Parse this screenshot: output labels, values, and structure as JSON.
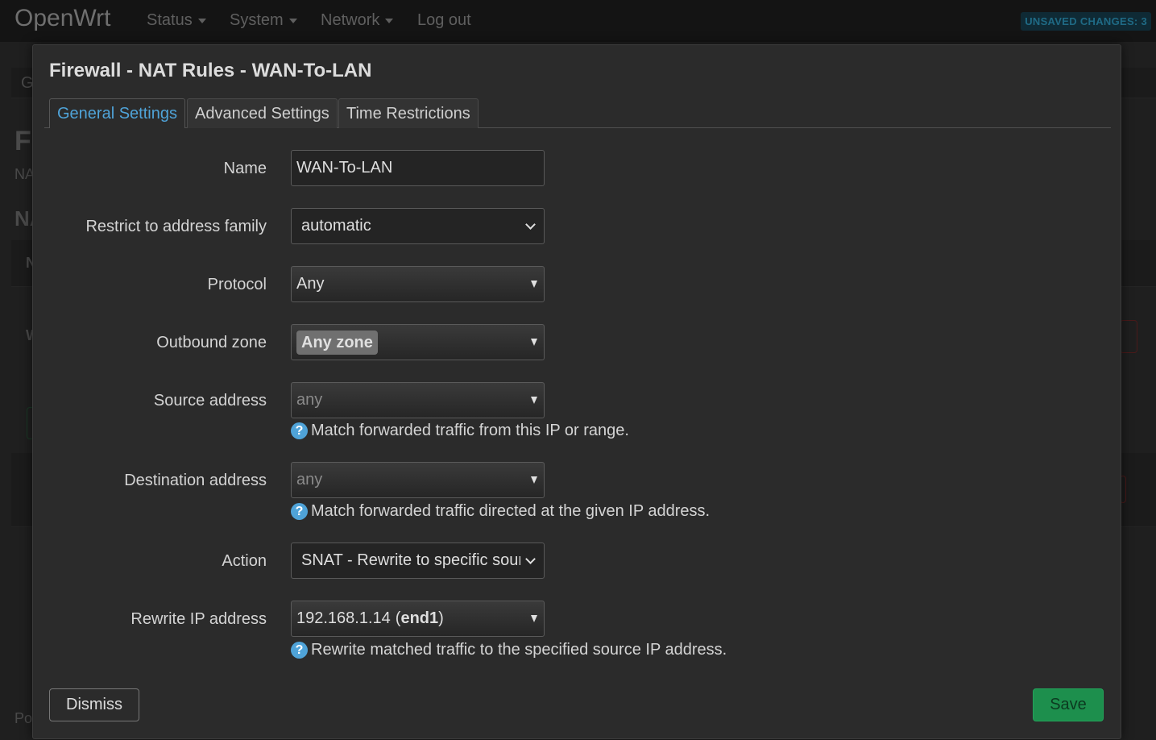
{
  "navbar": {
    "brand": "OpenWrt",
    "items": [
      {
        "label": "Status"
      },
      {
        "label": "System"
      },
      {
        "label": "Network"
      },
      {
        "label": "Log out"
      }
    ],
    "unsaved_badge": "UNSAVED CHANGES: 3"
  },
  "background": {
    "tab_fragment": "G",
    "heading_fragment": "F",
    "subheading_fragment": "NA",
    "section_fragment": "NA",
    "col_fragment": "N",
    "row_fragment": "W",
    "footer_fragment": "Po"
  },
  "modal": {
    "title": "Firewall - NAT Rules - WAN-To-LAN",
    "tabs": [
      {
        "label": "General Settings",
        "active": true
      },
      {
        "label": "Advanced Settings",
        "active": false
      },
      {
        "label": "Time Restrictions",
        "active": false
      }
    ],
    "fields": {
      "name": {
        "label": "Name",
        "value": "WAN-To-LAN"
      },
      "family": {
        "label": "Restrict to address family",
        "value": "automatic"
      },
      "protocol": {
        "label": "Protocol",
        "value": "Any"
      },
      "outbound_zone": {
        "label": "Outbound zone",
        "value": "Any zone"
      },
      "source_address": {
        "label": "Source address",
        "placeholder": "any",
        "help": "Match forwarded traffic from this IP or range."
      },
      "destination_address": {
        "label": "Destination address",
        "placeholder": "any",
        "help": "Match forwarded traffic directed at the given IP address."
      },
      "action": {
        "label": "Action",
        "value": "SNAT - Rewrite to specific sour"
      },
      "rewrite_ip": {
        "label": "Rewrite IP address",
        "value_ip": "192.168.1.14",
        "value_iface": "end1",
        "help": "Rewrite matched traffic to the specified source IP address."
      }
    },
    "help_icon_glyph": "?",
    "dismiss_label": "Dismiss",
    "save_label": "Save"
  },
  "colors": {
    "accent": "#4fa3d8",
    "save": "#1d8f4d",
    "background": "#1f1f1f",
    "modal": "#2b2b2b"
  }
}
